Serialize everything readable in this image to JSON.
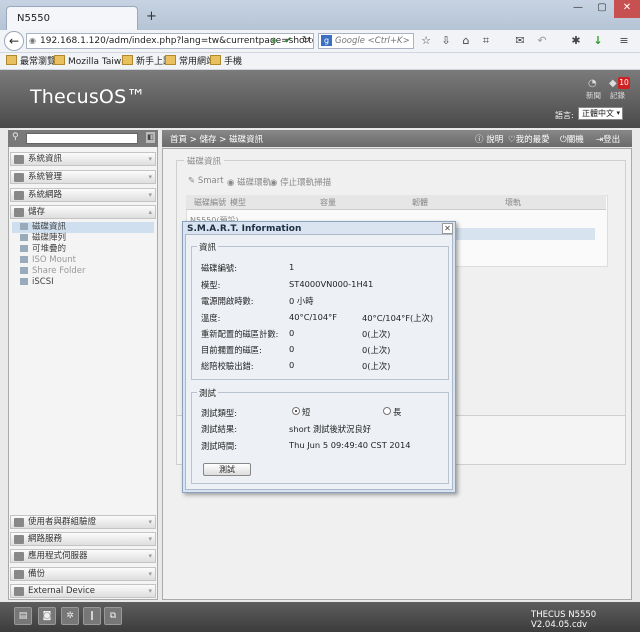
{
  "browser": {
    "tab_title": "N5550",
    "new_tab": "+",
    "win_controls": [
      "—",
      "▢",
      "✕"
    ],
    "url": "192.168.1.120/adm/index.php?lang=tw&currentpage=shortcut",
    "search_placeholder": "Google <Ctrl+K>",
    "bookmarks": [
      "最常瀏覽",
      "Mozilla Taiwan",
      "新手上路",
      "常用網站",
      "手機"
    ]
  },
  "header": {
    "logo": "ThecusOS™",
    "news_label": "新聞",
    "log_label": "記錄",
    "log_count": "10",
    "language_label": "語言:",
    "language_value": "正體中文"
  },
  "sidebar": {
    "categories_top": [
      {
        "label": "系統資訊"
      },
      {
        "label": "系統管理"
      },
      {
        "label": "系統網路"
      },
      {
        "label": "儲存"
      }
    ],
    "storage_items": [
      {
        "label": "磁碟資訊",
        "selected": true,
        "dim": false
      },
      {
        "label": "磁碟陣列",
        "selected": false,
        "dim": false
      },
      {
        "label": "可堆疊的",
        "selected": false,
        "dim": false
      },
      {
        "label": "ISO Mount",
        "selected": false,
        "dim": true
      },
      {
        "label": "Share Folder",
        "selected": false,
        "dim": true
      },
      {
        "label": "iSCSI",
        "selected": false,
        "dim": false
      }
    ],
    "categories_bottom": [
      {
        "label": "使用者與群組驗證"
      },
      {
        "label": "網路服務"
      },
      {
        "label": "應用程式伺服器"
      },
      {
        "label": "備份"
      },
      {
        "label": "External Device"
      }
    ]
  },
  "breadcrumb": {
    "home": "首頁",
    "sep1": ">",
    "section": "儲存",
    "sep2": ">",
    "page": "磁碟資訊"
  },
  "top_actions": {
    "help": "說明",
    "favorite": "我的最愛",
    "shutdown": "關機",
    "logout": "登出"
  },
  "background_panel": {
    "title": "磁碟資訊",
    "tool_smart": "Smart",
    "tool_scan": "磁碟環軌",
    "tool_stop": "停止環軌掃描",
    "columns": [
      "磁碟編號",
      "模型",
      "容量",
      "韌體",
      "壞軌"
    ],
    "group_row": "N5550(預設)"
  },
  "modal": {
    "title": "S.M.A.R.T. Information",
    "info_legend": "資訊",
    "rows": [
      {
        "label": "磁碟編號:",
        "value": "1",
        "extra": ""
      },
      {
        "label": "模型:",
        "value": "ST4000VN000-1H41",
        "extra": ""
      },
      {
        "label": "電源開啟時數:",
        "value": "0 小時",
        "extra": ""
      },
      {
        "label": "溫度:",
        "value": "40°C/104°F",
        "extra": "40°C/104°F(上次)"
      },
      {
        "label": "重新配置的磁區計數:",
        "value": "0",
        "extra": "0(上次)"
      },
      {
        "label": "目前擱置的磁區:",
        "value": "0",
        "extra": "0(上次)"
      },
      {
        "label": "総陪校驗出錯:",
        "value": "0",
        "extra": "0(上次)"
      }
    ],
    "test_legend": "測試",
    "test_type_label": "測試類型:",
    "test_type_short": "短",
    "test_type_long": "長",
    "test_type_selected": "short",
    "test_result_label": "測試結果:",
    "test_result_value": "short 測試後狀況良好",
    "test_time_label": "測試時間:",
    "test_time_value": "Thu Jun 5 09:49:40 CST 2014",
    "test_button": "測試"
  },
  "footer": {
    "version": "THECUS N5550 V2.04.05.cdv"
  }
}
